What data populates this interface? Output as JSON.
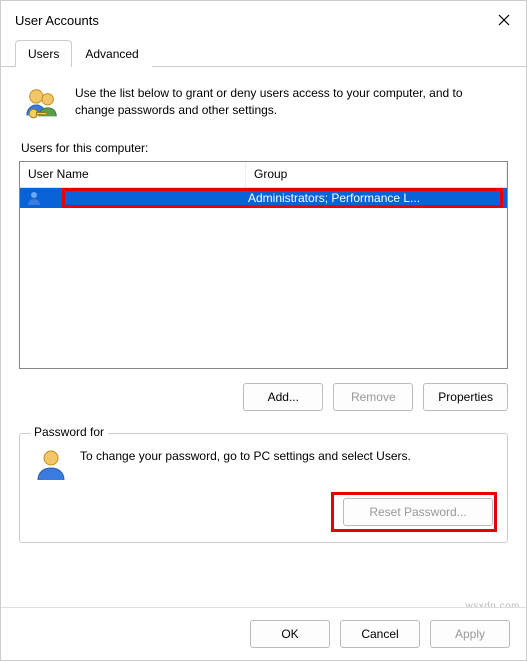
{
  "window": {
    "title": "User Accounts"
  },
  "tabs": {
    "items": [
      {
        "label": "Users"
      },
      {
        "label": "Advanced"
      }
    ],
    "active": 0
  },
  "intro": {
    "text": "Use the list below to grant or deny users access to your computer, and to change passwords and other settings."
  },
  "list": {
    "label": "Users for this computer:",
    "columns": {
      "name": "User Name",
      "group": "Group"
    },
    "rows": [
      {
        "name": "",
        "group": "Administrators; Performance L...",
        "selected": true
      }
    ]
  },
  "buttons": {
    "add": "Add...",
    "remove": "Remove",
    "properties": "Properties"
  },
  "password": {
    "legend": "Password for",
    "text": "To change your password, go to PC settings and select Users.",
    "reset": "Reset Password..."
  },
  "footer": {
    "ok": "OK",
    "cancel": "Cancel",
    "apply": "Apply"
  },
  "watermark": "wsxdn.com"
}
